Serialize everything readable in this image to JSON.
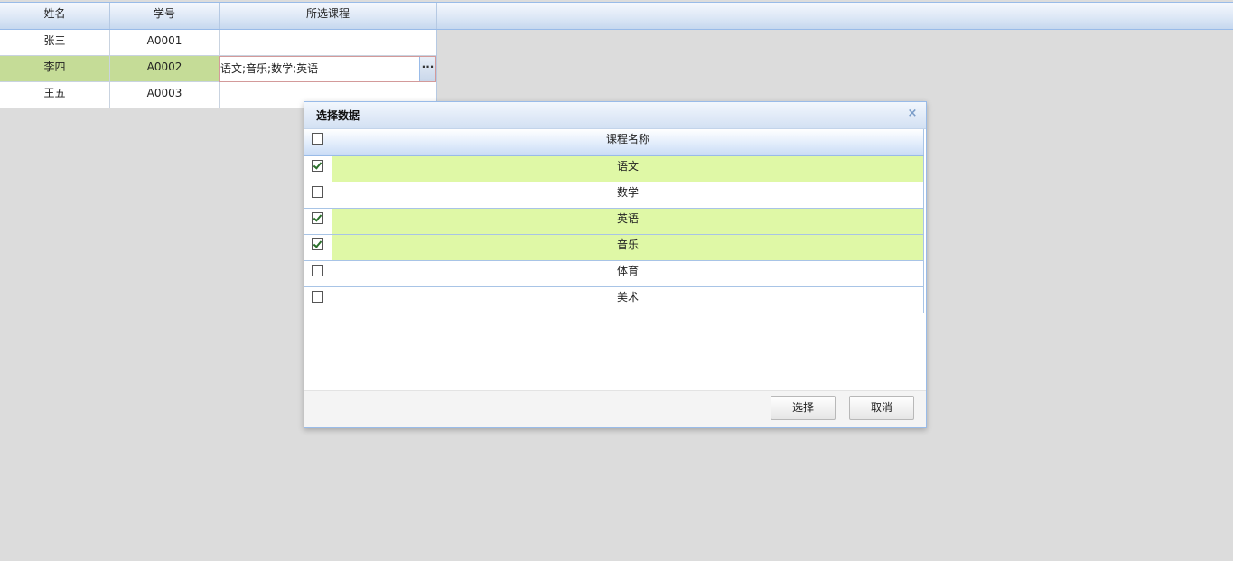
{
  "main_grid": {
    "columns": [
      "姓名",
      "学号",
      "所选课程"
    ],
    "rows": [
      {
        "name": "张三",
        "id": "A0001",
        "courses": ""
      },
      {
        "name": "李四",
        "id": "A0002",
        "courses": "语文;音乐;数学;英语"
      },
      {
        "name": "王五",
        "id": "A0003",
        "courses": ""
      }
    ],
    "selected_row": 1,
    "editor_button_label": "···"
  },
  "dialog": {
    "title": "选择数据",
    "close_icon": "×",
    "column_header": "课程名称",
    "items": [
      {
        "label": "语文",
        "checked": true
      },
      {
        "label": "数学",
        "checked": false
      },
      {
        "label": "英语",
        "checked": true
      },
      {
        "label": "音乐",
        "checked": true
      },
      {
        "label": "体育",
        "checked": false
      },
      {
        "label": "美术",
        "checked": false
      }
    ],
    "select_all_checked": false,
    "select_button": "选择",
    "cancel_button": "取消"
  },
  "colors": {
    "selected_row": "#c5dc97",
    "checked_row": "#dff8a6",
    "border_blue": "#99bbe8"
  }
}
